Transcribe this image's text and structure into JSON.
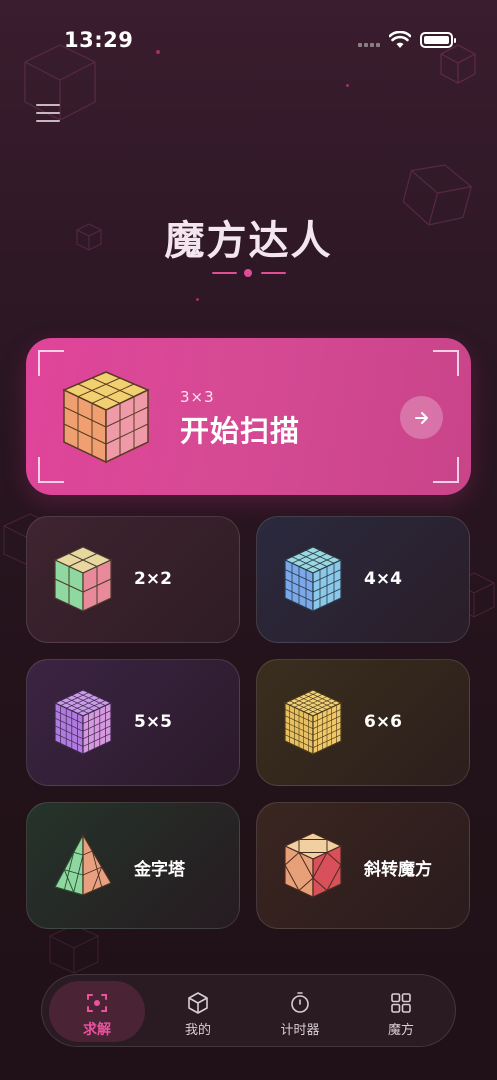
{
  "status_bar": {
    "time": "13:29"
  },
  "header": {
    "title": "魔方达人",
    "menu_icon": "hamburger-menu-icon"
  },
  "scan_card": {
    "subtitle": "3×3",
    "title": "开始扫描",
    "arrow_icon": "arrow-right-icon"
  },
  "cubes": [
    {
      "label": "2×2",
      "icon": "cube-2x2-icon"
    },
    {
      "label": "4×4",
      "icon": "cube-4x4-icon"
    },
    {
      "label": "5×5",
      "icon": "cube-5x5-icon"
    },
    {
      "label": "6×6",
      "icon": "cube-6x6-icon"
    },
    {
      "label": "金字塔",
      "icon": "pyramid-icon"
    },
    {
      "label": "斜转魔方",
      "icon": "skewb-icon"
    }
  ],
  "tabbar": {
    "tabs": [
      {
        "label": "求解",
        "icon": "scan-icon",
        "active": true
      },
      {
        "label": "我的",
        "icon": "box-icon",
        "active": false
      },
      {
        "label": "计时器",
        "icon": "timer-icon",
        "active": false
      },
      {
        "label": "魔方",
        "icon": "grid-icon",
        "active": false
      }
    ]
  },
  "colors": {
    "accent": "#e0449a",
    "background": "#2a1622",
    "active_tab": "#e9529e"
  }
}
